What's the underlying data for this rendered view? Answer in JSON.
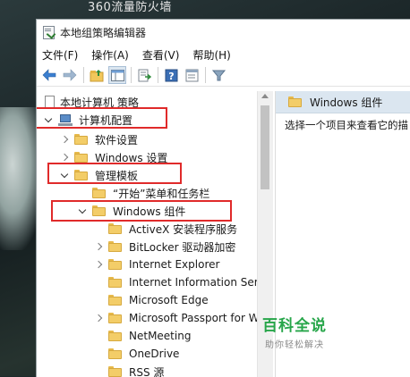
{
  "desktop": {
    "background_text": "360流量防火墙"
  },
  "window": {
    "title": "本地组策略编辑器",
    "menu": [
      "文件(F)",
      "操作(A)",
      "查看(V)",
      "帮助(H)"
    ]
  },
  "toolbar": {
    "icons": [
      "back-arrow-icon",
      "forward-arrow-icon",
      "up-folder-icon",
      "show-hide-tree-icon",
      "export-list-icon",
      "help-icon",
      "properties-icon",
      "filter-icon"
    ]
  },
  "tree": {
    "root": "本地计算机 策略",
    "computer_config": "计算机配置",
    "software_settings": "软件设置",
    "windows_settings": "Windows 设置",
    "admin_templates": "管理模板",
    "start_menu": "“开始”菜单和任务栏",
    "windows_components": "Windows 组件",
    "children": [
      {
        "label": "ActiveX 安装程序服务",
        "expandable": false
      },
      {
        "label": "BitLocker 驱动器加密",
        "expandable": true
      },
      {
        "label": "Internet Explorer",
        "expandable": true
      },
      {
        "label": "Internet Information Serv",
        "expandable": false
      },
      {
        "label": "Microsoft Edge",
        "expandable": false
      },
      {
        "label": "Microsoft Passport for W",
        "expandable": true
      },
      {
        "label": "NetMeeting",
        "expandable": false
      },
      {
        "label": "OneDrive",
        "expandable": false
      },
      {
        "label": "RSS 源",
        "expandable": false
      }
    ]
  },
  "detail": {
    "header": "Windows 组件",
    "description": "选择一个项目来查看它的描"
  },
  "watermark": {
    "main": "百科全说",
    "sub": "助你轻松解决"
  },
  "colors": {
    "highlight": "#e02a2a",
    "header_bg": "#dbe6f0",
    "watermark": "#27a64a"
  }
}
